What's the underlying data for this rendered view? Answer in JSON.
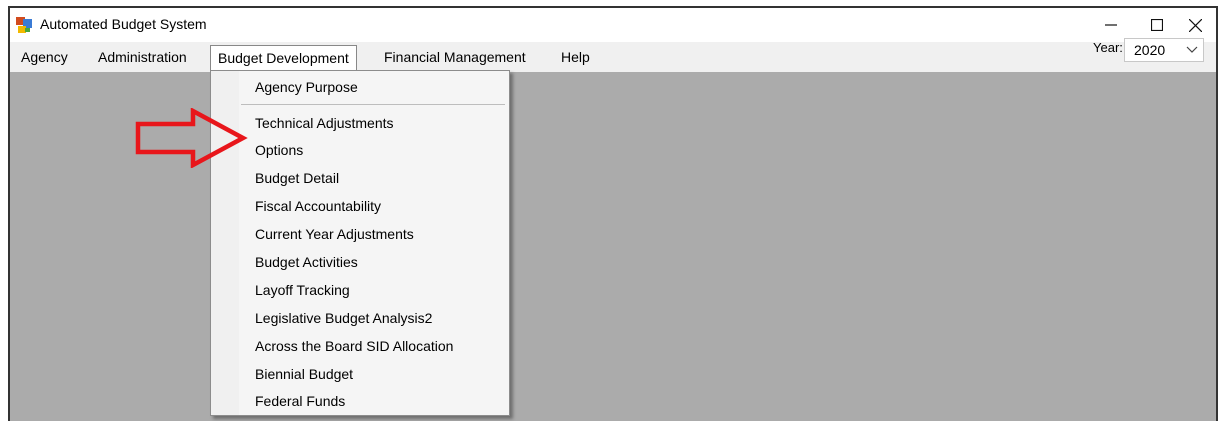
{
  "window": {
    "title": "Automated Budget System",
    "controls": [
      "minimize",
      "maximize",
      "close"
    ]
  },
  "menubar": {
    "items": [
      {
        "label": "Agency"
      },
      {
        "label": "Administration"
      },
      {
        "label": "Budget Development",
        "active": true
      },
      {
        "label": "Financial Management"
      },
      {
        "label": "Help"
      }
    ]
  },
  "year": {
    "label": "Year:",
    "selected": "2020"
  },
  "dropdown": {
    "items": [
      "Agency Purpose",
      "Technical Adjustments",
      "Options",
      "Budget Detail",
      "Fiscal Accountability",
      "Current Year Adjustments",
      "Budget Activities",
      "Layoff Tracking",
      "Legislative Budget Analysis2",
      "Across the Board SID Allocation",
      "Biennial Budget",
      "Federal Funds"
    ]
  },
  "annotation": {
    "type": "arrow",
    "color": "#e8161b",
    "points_to": "Technical Adjustments"
  },
  "colors": {
    "workspace": "#ababab",
    "menubar": "#f0f0f0",
    "annotation": "#e8161b"
  }
}
